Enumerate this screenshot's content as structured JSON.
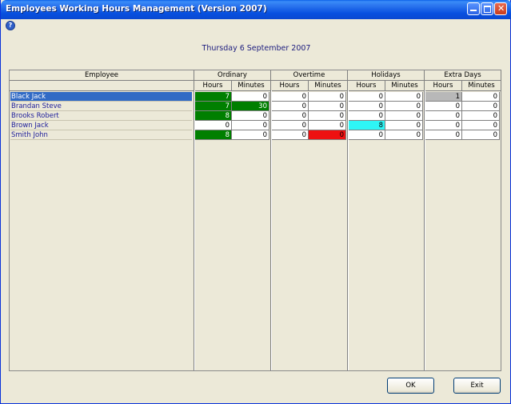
{
  "window": {
    "title": "Employees Working Hours Management (Version 2007)"
  },
  "date_label": "Thursday 6 September 2007",
  "grid": {
    "employee_header": "Employee",
    "groups": [
      "Ordinary",
      "Overtime",
      "Holidays",
      "Extra Days"
    ],
    "sub_headers": {
      "hours": "Hours",
      "minutes": "Minutes"
    },
    "rows": [
      {
        "name": "Black Jack",
        "values": [
          "7",
          "0",
          "0",
          "0",
          "0",
          "0",
          "1",
          "0"
        ]
      },
      {
        "name": "Brandan Steve",
        "values": [
          "7",
          "30",
          "0",
          "0",
          "0",
          "0",
          "0",
          "0"
        ]
      },
      {
        "name": "Brooks Robert",
        "values": [
          "8",
          "0",
          "0",
          "0",
          "0",
          "0",
          "0",
          "0"
        ]
      },
      {
        "name": "Brown Jack",
        "values": [
          "0",
          "0",
          "0",
          "0",
          "8",
          "0",
          "0",
          "0"
        ]
      },
      {
        "name": "Smith John",
        "values": [
          "8",
          "0",
          "0",
          "0",
          "0",
          "0",
          "0",
          "0"
        ]
      }
    ]
  },
  "buttons": {
    "ok": "OK",
    "exit": "Exit"
  },
  "colors": {
    "selected": "#316ac5",
    "green": "#007f00",
    "cyan": "#2ef5f5",
    "red": "#ee1111",
    "gray": "#b8b8b8"
  }
}
